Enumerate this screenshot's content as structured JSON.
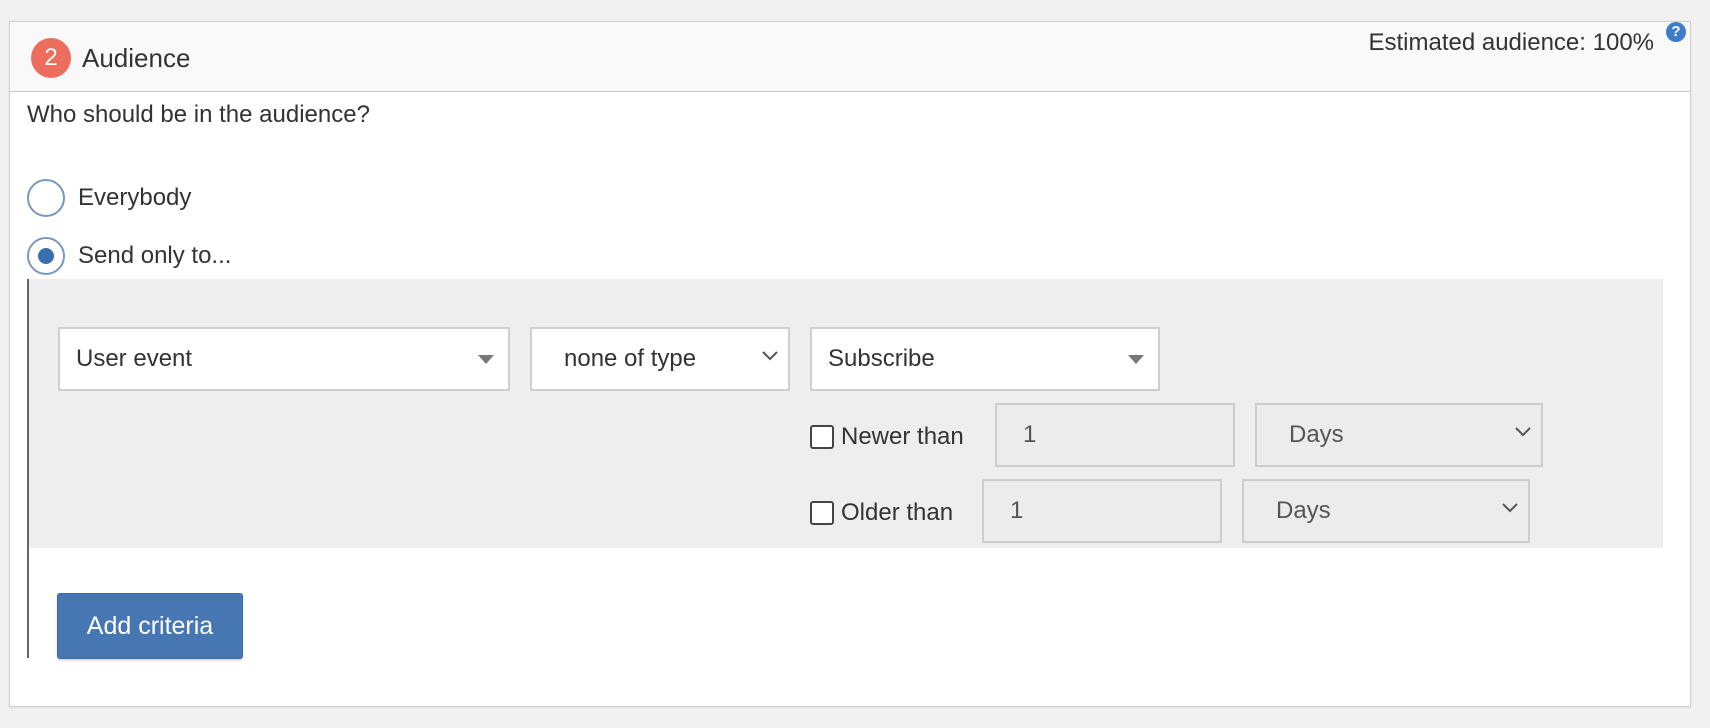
{
  "header": {
    "step_number": "2",
    "title": "Audience",
    "estimate": "Estimated audience: 100%",
    "help_symbol": "?"
  },
  "question": "Who should be in the audience?",
  "audience_options": [
    {
      "label": "Everybody",
      "selected": false
    },
    {
      "label": "Send only to...",
      "selected": true
    }
  ],
  "criteria": {
    "field_select": "User event",
    "operator_select": "none of type",
    "event_select": "Subscribe",
    "newer_than": {
      "label": "Newer than",
      "checked": false,
      "value": "1",
      "unit": "Days"
    },
    "older_than": {
      "label": "Older than",
      "checked": false,
      "value": "1",
      "unit": "Days"
    }
  },
  "add_criteria_label": "Add criteria",
  "colors": {
    "badge": "#ec6d5d",
    "primary_button": "#4677b3",
    "radio_selected": "#3a6fad",
    "help_icon": "#3d7cc9"
  },
  "icons": {
    "help": "help-circle-icon",
    "select_caret": "caret-down-icon",
    "select_chevron": "chevron-down-icon"
  }
}
